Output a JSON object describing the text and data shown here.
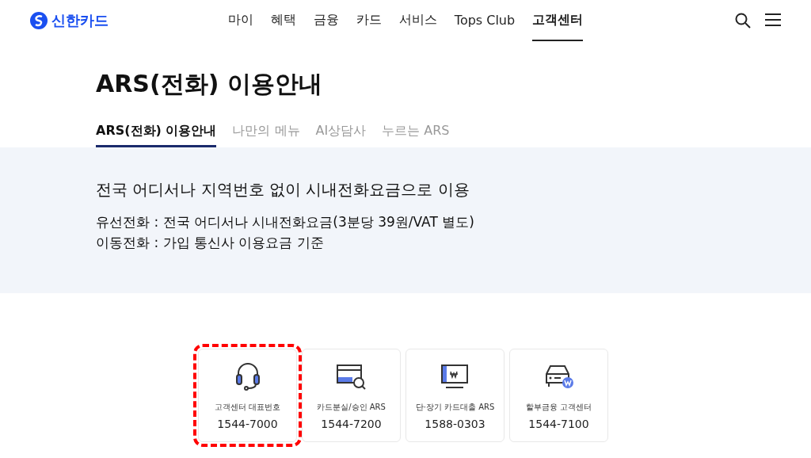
{
  "header": {
    "logo": "신한카드",
    "nav": [
      {
        "label": "마이",
        "selected": false
      },
      {
        "label": "혜택",
        "selected": false
      },
      {
        "label": "금융",
        "selected": false
      },
      {
        "label": "카드",
        "selected": false
      },
      {
        "label": "서비스",
        "selected": false
      },
      {
        "label": "Tops Club",
        "selected": false
      },
      {
        "label": "고객센터",
        "selected": true
      }
    ]
  },
  "page_title": "ARS(전화) 이용안내",
  "tabs": [
    {
      "label": "ARS(전화) 이용안내",
      "selected": true
    },
    {
      "label": "나만의 메뉴",
      "selected": false
    },
    {
      "label": "AI상담사",
      "selected": false
    },
    {
      "label": "누르는 ARS",
      "selected": false
    }
  ],
  "info": {
    "heading": "전국 어디서나 지역번호 없이 시내전화요금으로 이용",
    "lines": [
      "유선전화 : 전국 어디서나 시내전화요금(3분당 39원/VAT 별도)",
      "이동전화 : 가입 통신사 이용요금 기준"
    ]
  },
  "cards": [
    {
      "kind": "headset",
      "label": "고객센터 대표번호",
      "number": "1544-7000",
      "selected": true
    },
    {
      "kind": "card-search",
      "label": "카드분실/승인 ARS",
      "number": "1544-7200",
      "selected": false
    },
    {
      "kind": "monitor",
      "label": "단·장기 카드대출 ARS",
      "number": "1588-0303",
      "selected": false
    },
    {
      "kind": "car",
      "label": "할부금융 고객센터",
      "number": "1544-7100",
      "selected": false
    }
  ]
}
